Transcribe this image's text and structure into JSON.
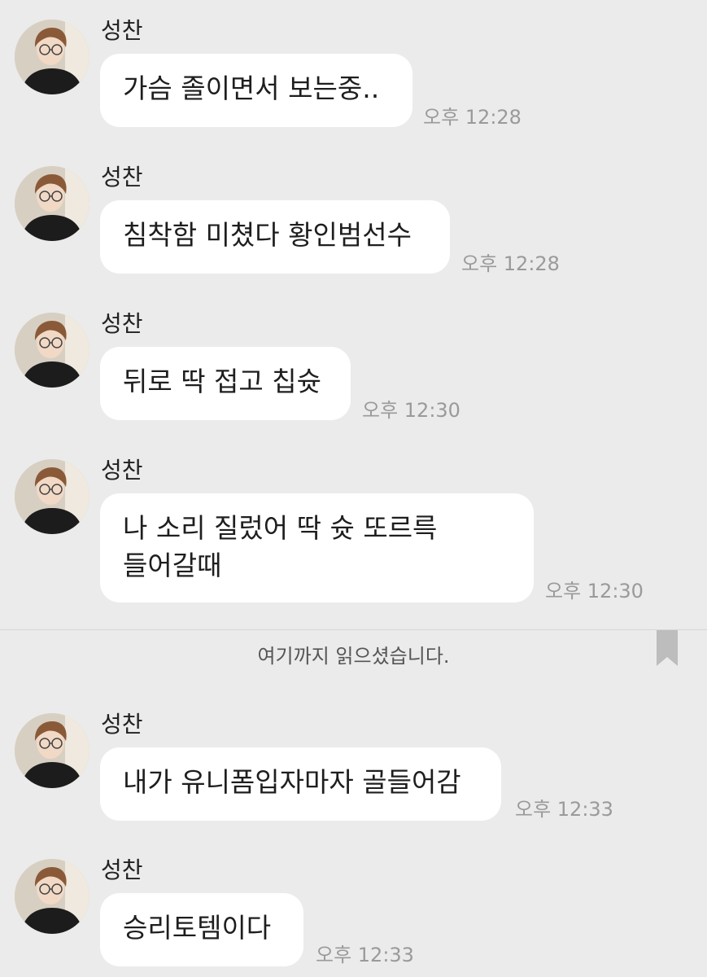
{
  "divider": {
    "label": "여기까지 읽으셨습니다."
  },
  "messages": [
    {
      "sender": "성찬",
      "text": "가슴 졸이면서 보는중..",
      "time": "오후 12:28"
    },
    {
      "sender": "성찬",
      "text": "침착함 미쳤다 황인범선수",
      "time": "오후 12:28"
    },
    {
      "sender": "성찬",
      "text": "뒤로 딱 접고 칩슛",
      "time": "오후 12:30"
    },
    {
      "sender": "성찬",
      "text": "나 소리 질렀어 딱 슛 또르륵\n들어갈때",
      "time": "오후 12:30"
    },
    {
      "sender": "성찬",
      "text": "내가 유니폼입자마자 골들어감",
      "time": "오후 12:33"
    },
    {
      "sender": "성찬",
      "text": "승리토템이다",
      "time": "오후 12:33"
    }
  ]
}
